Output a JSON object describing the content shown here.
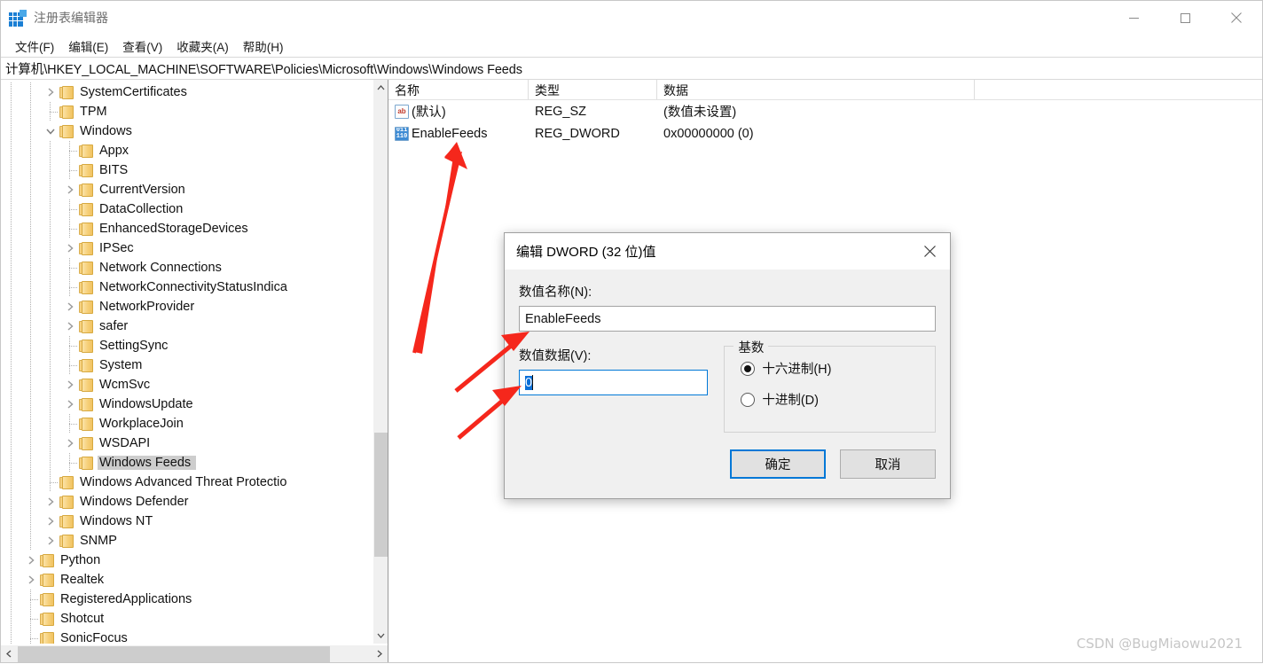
{
  "window": {
    "title": "注册表编辑器",
    "icon": "registry-editor-icon",
    "controls": {
      "minimize": "minimize-icon",
      "maximize": "maximize-icon",
      "close": "close-icon"
    }
  },
  "menubar": {
    "items": [
      {
        "label": "文件(F)"
      },
      {
        "label": "编辑(E)"
      },
      {
        "label": "查看(V)"
      },
      {
        "label": "收藏夹(A)"
      },
      {
        "label": "帮助(H)"
      }
    ]
  },
  "address": {
    "path": "计算机\\HKEY_LOCAL_MACHINE\\SOFTWARE\\Policies\\Microsoft\\Windows\\Windows Feeds"
  },
  "tree": {
    "nodes": [
      {
        "label": "SystemCertificates",
        "depth": 2,
        "expander": "collapsed",
        "selected": false
      },
      {
        "label": "TPM",
        "depth": 2,
        "expander": "none",
        "selected": false
      },
      {
        "label": "Windows",
        "depth": 2,
        "expander": "expanded",
        "selected": false
      },
      {
        "label": "Appx",
        "depth": 3,
        "expander": "none",
        "selected": false
      },
      {
        "label": "BITS",
        "depth": 3,
        "expander": "none",
        "selected": false
      },
      {
        "label": "CurrentVersion",
        "depth": 3,
        "expander": "collapsed",
        "selected": false
      },
      {
        "label": "DataCollection",
        "depth": 3,
        "expander": "none",
        "selected": false
      },
      {
        "label": "EnhancedStorageDevices",
        "depth": 3,
        "expander": "none",
        "selected": false
      },
      {
        "label": "IPSec",
        "depth": 3,
        "expander": "collapsed",
        "selected": false
      },
      {
        "label": "Network Connections",
        "depth": 3,
        "expander": "none",
        "selected": false
      },
      {
        "label": "NetworkConnectivityStatusIndica",
        "depth": 3,
        "expander": "none",
        "selected": false
      },
      {
        "label": "NetworkProvider",
        "depth": 3,
        "expander": "collapsed",
        "selected": false
      },
      {
        "label": "safer",
        "depth": 3,
        "expander": "collapsed",
        "selected": false
      },
      {
        "label": "SettingSync",
        "depth": 3,
        "expander": "none",
        "selected": false
      },
      {
        "label": "System",
        "depth": 3,
        "expander": "none",
        "selected": false
      },
      {
        "label": "WcmSvc",
        "depth": 3,
        "expander": "collapsed",
        "selected": false
      },
      {
        "label": "WindowsUpdate",
        "depth": 3,
        "expander": "collapsed",
        "selected": false
      },
      {
        "label": "WorkplaceJoin",
        "depth": 3,
        "expander": "none",
        "selected": false
      },
      {
        "label": "WSDAPI",
        "depth": 3,
        "expander": "collapsed",
        "selected": false
      },
      {
        "label": "Windows Feeds",
        "depth": 3,
        "expander": "none",
        "selected": true
      },
      {
        "label": "Windows Advanced Threat Protectio",
        "depth": 2,
        "expander": "none",
        "selected": false
      },
      {
        "label": "Windows Defender",
        "depth": 2,
        "expander": "collapsed",
        "selected": false
      },
      {
        "label": "Windows NT",
        "depth": 2,
        "expander": "collapsed",
        "selected": false
      },
      {
        "label": "SNMP",
        "depth": 2,
        "expander": "collapsed",
        "selected": false
      },
      {
        "label": "Python",
        "depth": 1,
        "expander": "collapsed",
        "selected": false
      },
      {
        "label": "Realtek",
        "depth": 1,
        "expander": "collapsed",
        "selected": false
      },
      {
        "label": "RegisteredApplications",
        "depth": 1,
        "expander": "none",
        "selected": false
      },
      {
        "label": "Shotcut",
        "depth": 1,
        "expander": "none",
        "selected": false
      },
      {
        "label": "SonicFocus",
        "depth": 1,
        "expander": "none",
        "selected": false
      }
    ],
    "scroll_up_icon": "chevron-up-icon",
    "scroll_down_icon": "chevron-down-icon",
    "scroll_left_icon": "chevron-left-icon",
    "scroll_right_icon": "chevron-right-icon"
  },
  "values": {
    "columns": [
      {
        "label": "名称"
      },
      {
        "label": "类型"
      },
      {
        "label": "数据"
      }
    ],
    "rows": [
      {
        "icon": "string-value-icon",
        "icon_text": "ab",
        "name": "(默认)",
        "type": "REG_SZ",
        "data": "(数值未设置)"
      },
      {
        "icon": "dword-value-icon",
        "icon_text_top": "011",
        "icon_text_bottom": "110",
        "name": "EnableFeeds",
        "type": "REG_DWORD",
        "data": "0x00000000 (0)"
      }
    ]
  },
  "dialog": {
    "title": "编辑 DWORD (32 位)值",
    "close_icon": "close-icon",
    "value_name_label": "数值名称(N):",
    "value_name": "EnableFeeds",
    "value_data_label": "数值数据(V):",
    "value_data": "0",
    "base_group_label": "基数",
    "base_options": [
      {
        "label": "十六进制(H)",
        "checked": true
      },
      {
        "label": "十进制(D)",
        "checked": false
      }
    ],
    "ok_label": "确定",
    "cancel_label": "取消"
  },
  "annotations": {
    "arrow_color": "#f5271c",
    "count": 3
  },
  "watermark": {
    "text": "CSDN @BugMiaowu2021"
  }
}
